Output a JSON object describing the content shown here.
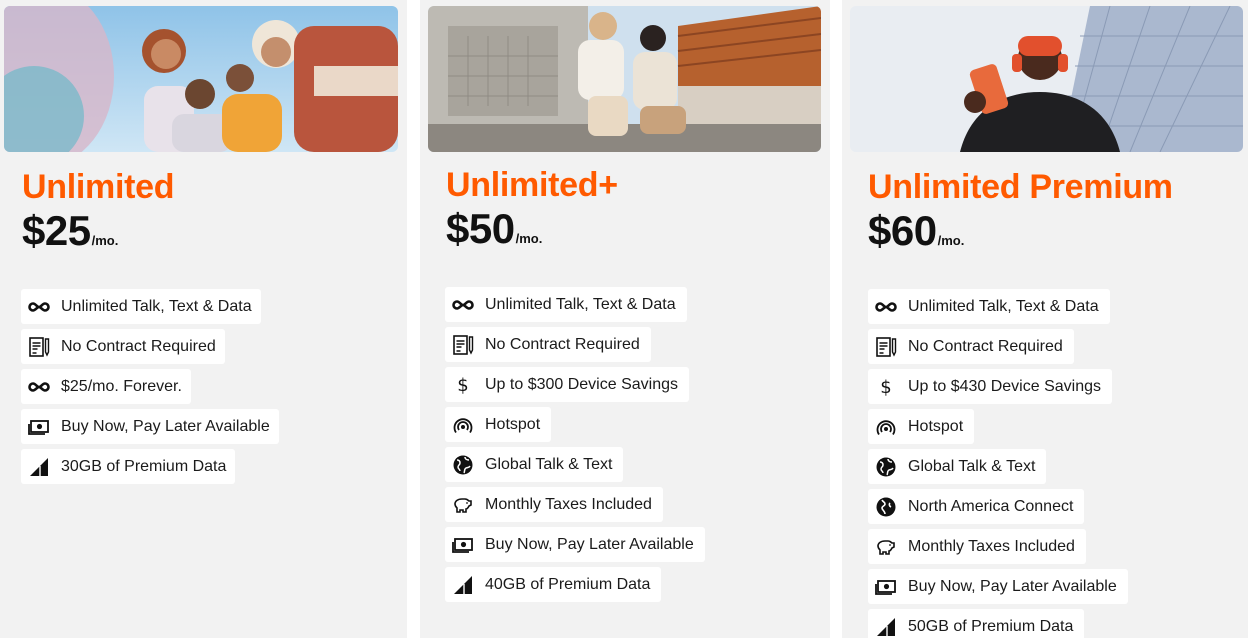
{
  "colors": {
    "accent": "#ff5a00",
    "card_bg": "#f2f2f2",
    "pill_bg": "#ffffff",
    "text": "#111111"
  },
  "plans": [
    {
      "name": "Unlimited",
      "price": "$25",
      "per": "/mo.",
      "features": [
        {
          "icon": "infinity-icon",
          "label": "Unlimited Talk, Text & Data"
        },
        {
          "icon": "contract-icon",
          "label": "No Contract Required"
        },
        {
          "icon": "infinity-icon",
          "label": "$25/mo. Forever."
        },
        {
          "icon": "cash-icon",
          "label": "Buy Now, Pay Later Available"
        },
        {
          "icon": "signal-icon",
          "label": "30GB of Premium Data"
        }
      ]
    },
    {
      "name": "Unlimited+",
      "price": "$50",
      "per": "/mo.",
      "features": [
        {
          "icon": "infinity-icon",
          "label": "Unlimited Talk, Text & Data"
        },
        {
          "icon": "contract-icon",
          "label": "No Contract Required"
        },
        {
          "icon": "dollar-icon",
          "label": "Up to $300 Device Savings"
        },
        {
          "icon": "hotspot-icon",
          "label": "Hotspot"
        },
        {
          "icon": "globe-icon",
          "label": "Global Talk & Text"
        },
        {
          "icon": "piggy-bank-icon",
          "label": "Monthly Taxes Included"
        },
        {
          "icon": "cash-icon",
          "label": "Buy Now, Pay Later Available"
        },
        {
          "icon": "signal-icon",
          "label": "40GB of Premium Data"
        }
      ]
    },
    {
      "name": "Unlimited Premium",
      "price": "$60",
      "per": "/mo.",
      "features": [
        {
          "icon": "infinity-icon",
          "label": "Unlimited Talk, Text & Data"
        },
        {
          "icon": "contract-icon",
          "label": "No Contract Required"
        },
        {
          "icon": "dollar-icon",
          "label": "Up to $430 Device Savings"
        },
        {
          "icon": "hotspot-icon",
          "label": "Hotspot"
        },
        {
          "icon": "globe-icon",
          "label": "Global Talk & Text"
        },
        {
          "icon": "globe-americas-icon",
          "label": "North America Connect"
        },
        {
          "icon": "piggy-bank-icon",
          "label": "Monthly Taxes Included"
        },
        {
          "icon": "cash-icon",
          "label": "Buy Now, Pay Later Available"
        },
        {
          "icon": "signal-icon",
          "label": "50GB of Premium Data"
        }
      ]
    }
  ]
}
